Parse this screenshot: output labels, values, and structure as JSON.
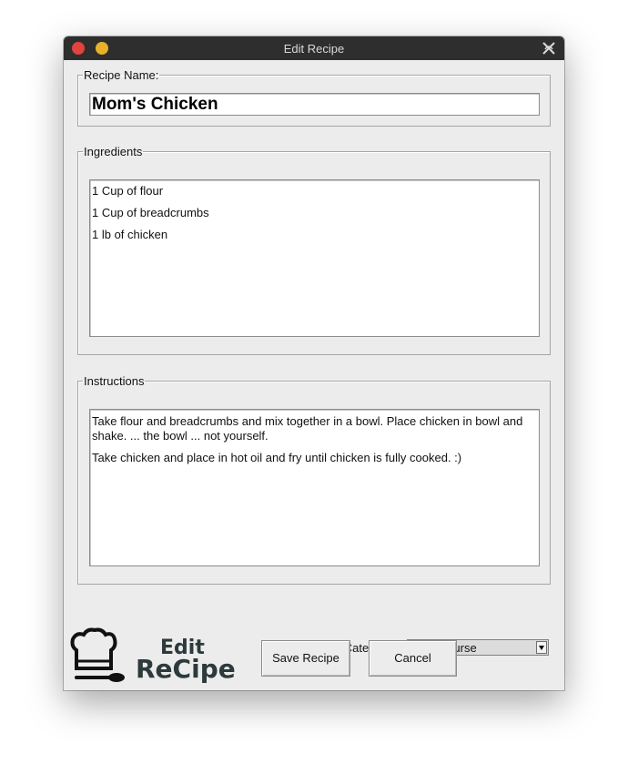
{
  "window": {
    "title": "Edit Recipe"
  },
  "recipe_name": {
    "legend": "Recipe Name:",
    "value": "Mom's Chicken"
  },
  "ingredients": {
    "legend": "Ingredients",
    "lines": [
      "1 Cup of flour",
      "1 Cup of breadcrumbs",
      "1 lb of chicken"
    ]
  },
  "instructions": {
    "legend": "Instructions",
    "lines": [
      "Take flour and breadcrumbs and mix together in a bowl. Place chicken in bowl and shake. ... the bowl ... not yourself.",
      "Take chicken and place in hot oil and fry until chicken is fully cooked. :)"
    ]
  },
  "category": {
    "label": "Select Category:",
    "selected": "Main Course"
  },
  "buttons": {
    "save": "Save Recipe",
    "cancel": "Cancel"
  },
  "logo": {
    "line1": "Edit",
    "line2": "ReCipe"
  },
  "colors": {
    "titlebar": "#2e2e2e",
    "close": "#e0443e",
    "minimize": "#e9b02a",
    "window_bg": "#ececec"
  }
}
